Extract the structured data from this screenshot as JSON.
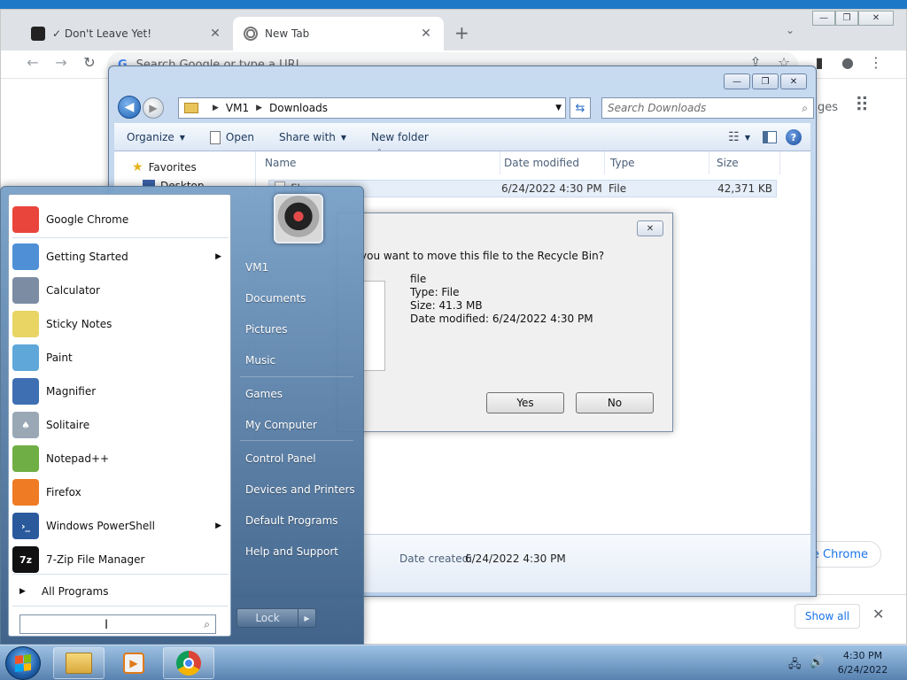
{
  "chrome": {
    "tabs": [
      {
        "title": "✓ Don't Leave Yet!",
        "close": "✕"
      },
      {
        "title": "New Tab",
        "close": "✕"
      }
    ],
    "new_tab": "+",
    "omnibox_placeholder": "Search Google or type a URL",
    "partial_ages_text": "ges",
    "partial_chrome_chip": "e Chrome",
    "downloads_bar": {
      "show_all": "Show all",
      "close": "✕"
    },
    "win_controls": {
      "minimize": "—",
      "restore": "❐",
      "close": "✕"
    }
  },
  "explorer": {
    "controls": {
      "minimize": "—",
      "restore": "❐",
      "close": "✕"
    },
    "breadcrumb": [
      "VM1",
      "Downloads"
    ],
    "search_placeholder": "Search Downloads",
    "commands": {
      "organize": "Organize",
      "open": "Open",
      "share_with": "Share with",
      "new_folder": "New folder"
    },
    "nav": {
      "favorites": "Favorites",
      "desktop": "Desktop"
    },
    "columns": {
      "name": "Name",
      "date_modified": "Date modified",
      "type": "Type",
      "size": "Size"
    },
    "files": [
      {
        "name": "file",
        "date_modified": "6/24/2022 4:30 PM",
        "type": "File",
        "size": "42,371 KB"
      }
    ],
    "details": {
      "label": "Date created:",
      "value": "6/24/2022 4:30 PM"
    }
  },
  "dialog": {
    "question": "you want to move this file to the Recycle Bin?",
    "file_name": "file",
    "file_type": "Type: File",
    "file_size": "Size: 41.3 MB",
    "file_date": "Date modified: 6/24/2022 4:30 PM",
    "yes": "Yes",
    "no": "No",
    "close": "✕"
  },
  "start_menu": {
    "programs": [
      {
        "label": "Google Chrome",
        "icon": "chrome-icon",
        "color": "#e9453c",
        "glyph": "",
        "has_submenu": false
      },
      {
        "label": "Getting Started",
        "icon": "getting-started-icon",
        "color": "#4f8fd6",
        "glyph": "",
        "has_submenu": true
      },
      {
        "label": "Calculator",
        "icon": "calculator-icon",
        "color": "#7c8da3",
        "glyph": "",
        "has_submenu": false
      },
      {
        "label": "Sticky Notes",
        "icon": "sticky-notes-icon",
        "color": "#e8d563",
        "glyph": "",
        "has_submenu": false
      },
      {
        "label": "Paint",
        "icon": "paint-icon",
        "color": "#5fa7d9",
        "glyph": "",
        "has_submenu": false
      },
      {
        "label": "Magnifier",
        "icon": "magnifier-icon",
        "color": "#3e6fb2",
        "glyph": "",
        "has_submenu": false
      },
      {
        "label": "Solitaire",
        "icon": "solitaire-icon",
        "color": "#9aa8b6",
        "glyph": "♠",
        "has_submenu": false
      },
      {
        "label": "Notepad++",
        "icon": "notepadpp-icon",
        "color": "#6fae44",
        "glyph": "",
        "has_submenu": false
      },
      {
        "label": "Firefox",
        "icon": "firefox-icon",
        "color": "#ef7b24",
        "glyph": "",
        "has_submenu": false
      },
      {
        "label": "Windows PowerShell",
        "icon": "powershell-icon",
        "color": "#2a5a9c",
        "glyph": "›_",
        "has_submenu": true
      },
      {
        "label": "7-Zip File Manager",
        "icon": "7zip-icon",
        "color": "#111111",
        "glyph": "7z",
        "has_submenu": false
      }
    ],
    "all_programs": "All Programs",
    "right_items": [
      "VM1",
      "Documents",
      "Pictures",
      "Music",
      "Games",
      "My Computer",
      "Control Panel",
      "Devices and Printers",
      "Default Programs",
      "Help and Support"
    ],
    "lock": "Lock"
  },
  "taskbar": {
    "time": "4:30 PM",
    "date": "6/24/2022"
  }
}
